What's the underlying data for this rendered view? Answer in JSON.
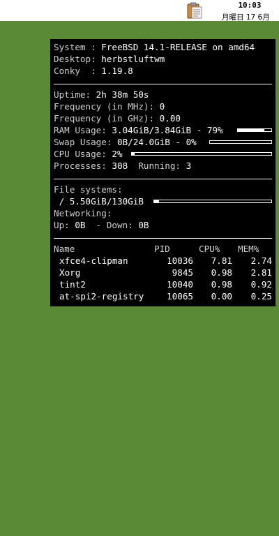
{
  "taskbar": {
    "clock_time": "10:03",
    "clock_date": "月曜日 17 6月",
    "tray_icon": "clipboard-icon"
  },
  "conky": {
    "system_label": "System : ",
    "system_value": "FreeBSD 14.1-RELEASE on amd64",
    "desktop_label": "Desktop: ",
    "desktop_value": "herbstluftwm",
    "conky_label": "Conky  : ",
    "conky_value": "1.19.8",
    "uptime_label": "Uptime: ",
    "uptime_value": "2h 38m 50s",
    "freq_mhz_label": "Frequency (in MHz): ",
    "freq_mhz_value": "0",
    "freq_ghz_label": "Frequency (in GHz): ",
    "freq_ghz_value": "0.00",
    "ram_label": "RAM Usage: ",
    "ram_value": "3.04GiB/3.84GiB - 79%",
    "ram_percent": 79,
    "swap_label": "Swap Usage: ",
    "swap_value": "0B/24.0GiB - 0%",
    "swap_percent": 0,
    "cpu_label": "CPU Usage: ",
    "cpu_value": "2%",
    "cpu_percent": 2,
    "processes_label": "Processes: ",
    "processes_value": "308",
    "running_label": "  Running: ",
    "running_value": "3",
    "fs_label": "File systems:",
    "fs_root_value": " / 5.50GiB/130GiB",
    "fs_root_percent": 4,
    "net_label": "Networking:",
    "up_label": "Up: ",
    "up_value": "0B",
    "down_label": "  - Down: ",
    "down_value": "0B",
    "table": {
      "headers": [
        "Name",
        "PID",
        "CPU%",
        "MEM%"
      ],
      "rows": [
        [
          "xfce4-clipman",
          "10036",
          "7.81",
          "2.74"
        ],
        [
          "Xorg",
          "9845",
          "0.98",
          "2.81"
        ],
        [
          "tint2",
          "10040",
          "0.98",
          "0.92"
        ],
        [
          "at-spi2-registry",
          "10065",
          "0.00",
          "0.25"
        ]
      ]
    }
  }
}
